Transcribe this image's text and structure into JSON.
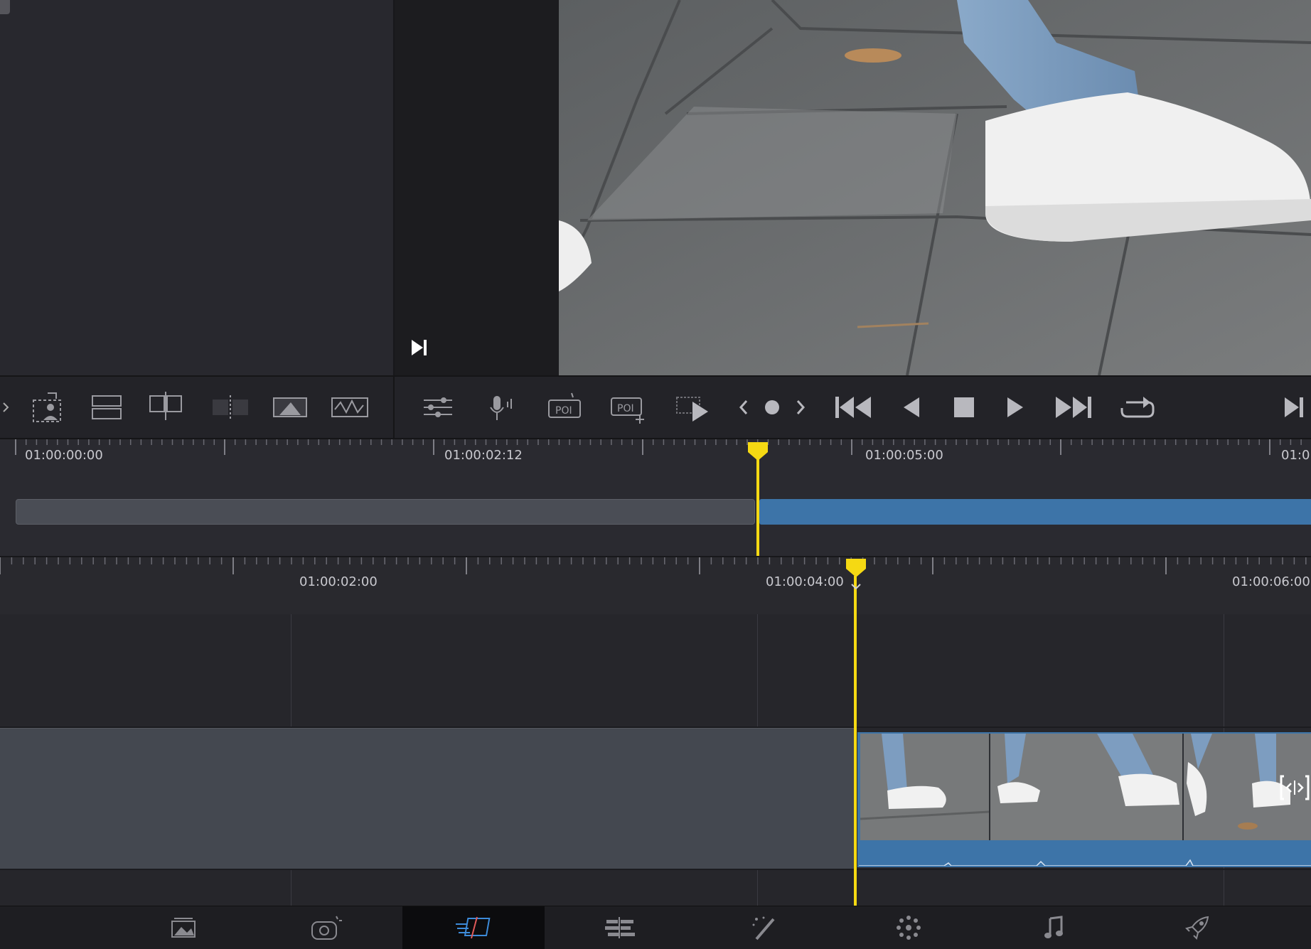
{
  "upper_timeline": {
    "timecodes": [
      "01:00:00:00",
      "01:00:02:12",
      "01:00:05:00",
      "01:0"
    ]
  },
  "lower_timeline": {
    "timecodes": [
      "01:00:02:00",
      "01:00:04:00",
      "01:00:06:00"
    ]
  },
  "toolbar": {
    "left_icons": [
      "chevron-right-icon",
      "smart-reframe-icon",
      "stack-icon",
      "insert-clip-icon",
      "split-icon",
      "fit-fill-icon",
      "audio-waveform-icon"
    ],
    "right_icons": [
      "mixer-icon",
      "voice-over-icon",
      "poi-icon",
      "poi-add-icon",
      "play-clip-icon",
      "prev-mark-icon",
      "mark-icon",
      "next-mark-icon",
      "skip-start-icon",
      "reverse-play-icon",
      "stop-icon",
      "play-icon",
      "skip-end-icon",
      "loop-icon",
      "go-to-end-icon"
    ]
  },
  "pages": [
    {
      "name": "media-page",
      "icon": "image-icon",
      "active": false
    },
    {
      "name": "cut-page-prev",
      "icon": "camera-icon",
      "active": false
    },
    {
      "name": "cut-page",
      "icon": "cut-icon",
      "active": true
    },
    {
      "name": "edit-page",
      "icon": "edit-timeline-icon",
      "active": false
    },
    {
      "name": "fusion-page",
      "icon": "wand-icon",
      "active": false
    },
    {
      "name": "color-page",
      "icon": "color-dots-icon",
      "active": false
    },
    {
      "name": "fairlight-page",
      "icon": "music-note-icon",
      "active": false
    },
    {
      "name": "deliver-page",
      "icon": "rocket-icon",
      "active": false
    }
  ],
  "colors": {
    "playhead": "#f5d913",
    "clip_blue": "#3d74a8",
    "active_page_icon": "#3d8bd9"
  }
}
